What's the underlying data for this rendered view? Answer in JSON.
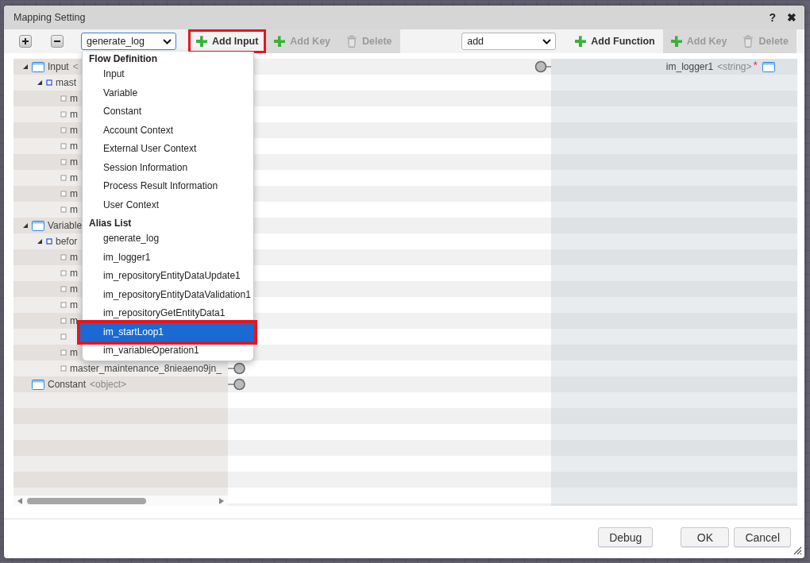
{
  "window": {
    "title": "Mapping Setting",
    "help": "?",
    "close": "✖"
  },
  "source_toolbar": {
    "select": {
      "value": "generate_log"
    },
    "buttons": [
      {
        "label": "Add Input",
        "kind": "add",
        "disabled": false,
        "callout": true
      },
      {
        "label": "Add Key",
        "kind": "add",
        "disabled": true,
        "callout": false
      },
      {
        "label": "Delete",
        "kind": "delete",
        "disabled": true,
        "callout": false
      }
    ]
  },
  "target_toolbar": {
    "select": {
      "value": "add"
    },
    "buttons": [
      {
        "label": "Add Function",
        "kind": "add",
        "disabled": false,
        "callout": false
      },
      {
        "label": "Add Key",
        "kind": "add",
        "disabled": true,
        "callout": false
      },
      {
        "label": "Delete",
        "kind": "delete",
        "disabled": true,
        "callout": false
      }
    ]
  },
  "source_tree": [
    {
      "label": "Input",
      "type": "<",
      "kind": "object",
      "expanded": true,
      "children": [
        {
          "label": "mast",
          "kind": "group",
          "expanded": true,
          "children": [
            {
              "label": "m",
              "kind": "leaf"
            },
            {
              "label": "m",
              "kind": "leaf"
            },
            {
              "label": "m",
              "kind": "leaf"
            },
            {
              "label": "m",
              "kind": "leaf"
            },
            {
              "label": "m",
              "kind": "leaf"
            },
            {
              "label": "m",
              "kind": "leaf"
            },
            {
              "label": "m",
              "kind": "leaf"
            },
            {
              "label": "m",
              "kind": "leaf"
            }
          ]
        }
      ]
    },
    {
      "label": "Variable",
      "kind": "object",
      "expanded": true,
      "children": [
        {
          "label": "befor",
          "kind": "group",
          "expanded": true,
          "children": [
            {
              "label": "m",
              "kind": "leaf"
            },
            {
              "label": "m",
              "kind": "leaf"
            },
            {
              "label": "m",
              "kind": "leaf"
            },
            {
              "label": "m",
              "kind": "leaf"
            },
            {
              "label": "m",
              "kind": "leaf"
            },
            {
              "kind": "leaf"
            },
            {
              "label": "m",
              "kind": "leaf"
            },
            {
              "label": "master_maintenance_8nieaeno9jn_",
              "kind": "leaf",
              "port": true
            }
          ]
        }
      ]
    },
    {
      "label": "Constant",
      "type": "<object>",
      "kind": "object",
      "port": true
    }
  ],
  "target_tree": [
    {
      "label": "im_logger1",
      "type": "<string>",
      "kind": "object",
      "required_mark": "*",
      "port": true
    }
  ],
  "menu": {
    "groups": [
      {
        "label": "Flow Definition",
        "items": [
          {
            "label": "Input",
            "selected": false,
            "callout": false
          },
          {
            "label": "Variable",
            "selected": false,
            "callout": false
          },
          {
            "label": "Constant",
            "selected": false,
            "callout": false
          },
          {
            "label": "Account Context",
            "selected": false,
            "callout": false
          },
          {
            "label": "External User Context",
            "selected": false,
            "callout": false
          },
          {
            "label": "Session Information",
            "selected": false,
            "callout": false
          },
          {
            "label": "Process Result Information",
            "selected": false,
            "callout": false
          },
          {
            "label": "User Context",
            "selected": false,
            "callout": false
          }
        ]
      },
      {
        "label": "Alias List",
        "items": [
          {
            "label": "generate_log",
            "selected": false,
            "callout": false
          },
          {
            "label": "im_logger1",
            "selected": false,
            "callout": false
          },
          {
            "label": "im_repositoryEntityDataUpdate1",
            "selected": false,
            "callout": false
          },
          {
            "label": "im_repositoryEntityDataValidation1",
            "selected": false,
            "callout": false
          },
          {
            "label": "im_repositoryGetEntityData1",
            "selected": false,
            "callout": false
          },
          {
            "label": "im_startLoop1",
            "selected": true,
            "callout": true
          },
          {
            "label": "im_variableOperation1",
            "selected": false,
            "callout": false
          }
        ]
      }
    ]
  },
  "footer": {
    "buttons": [
      {
        "label": "Debug"
      },
      {
        "label": "OK"
      },
      {
        "label": "Cancel"
      }
    ]
  }
}
